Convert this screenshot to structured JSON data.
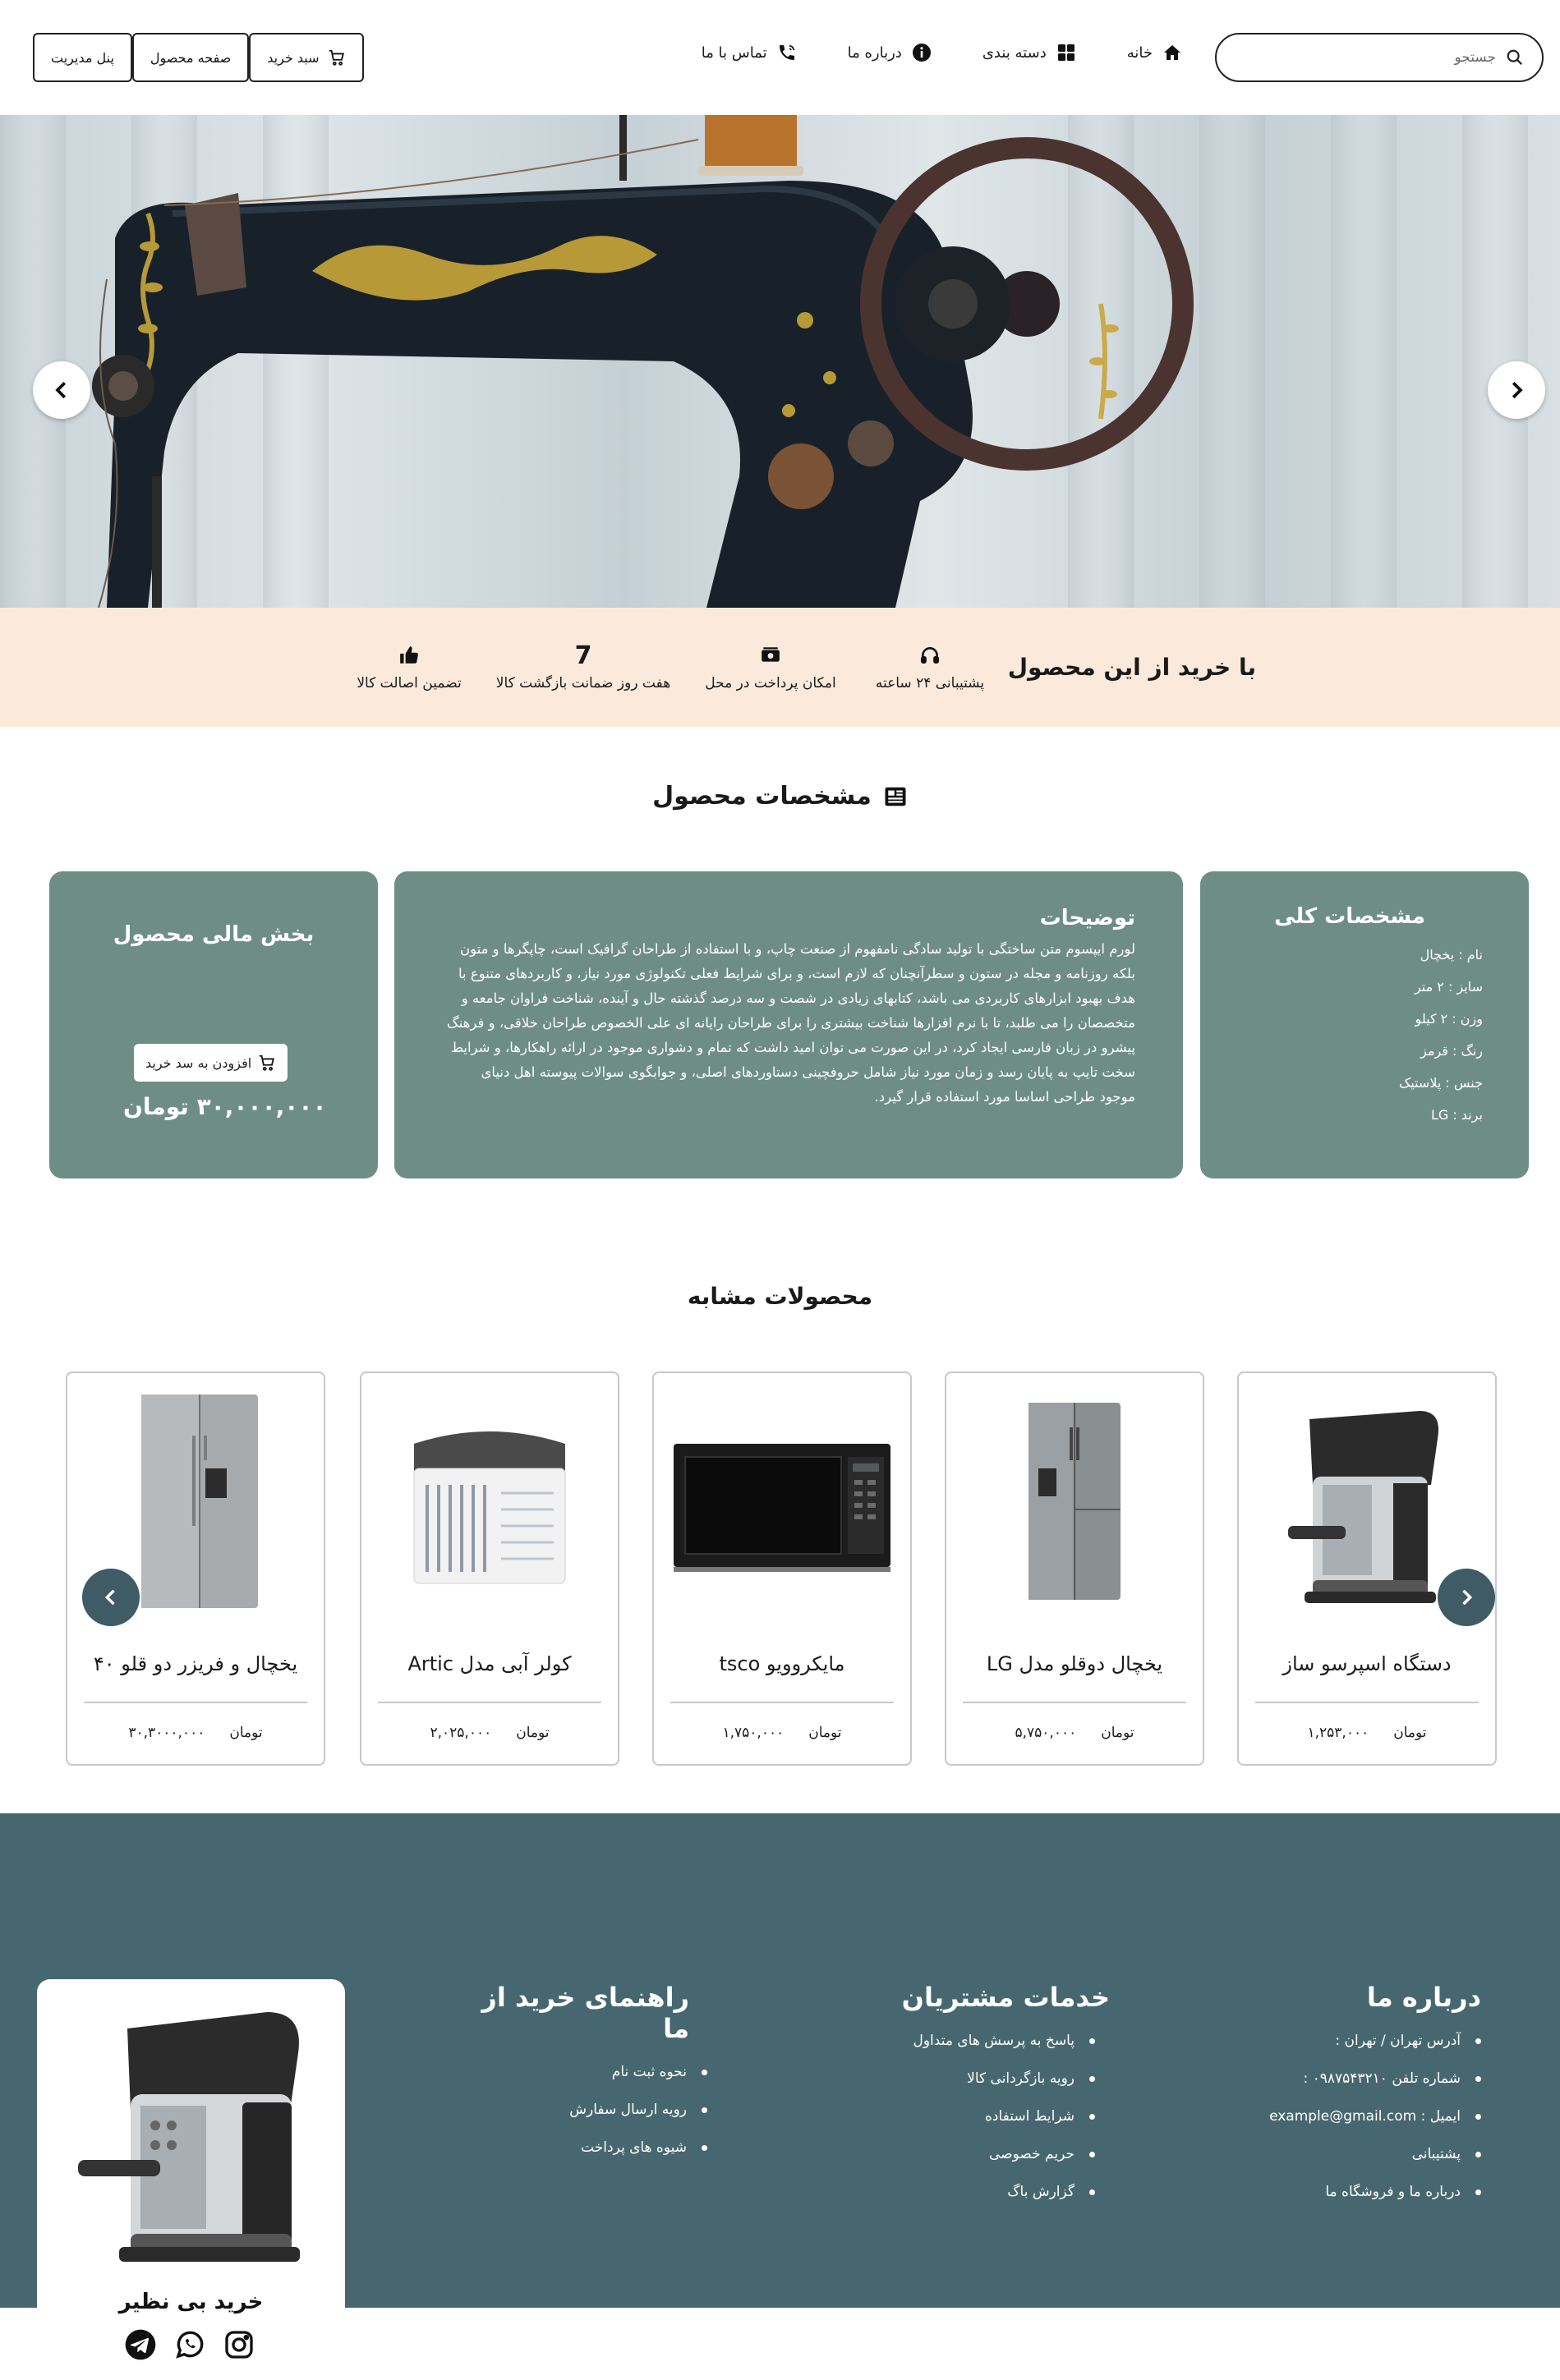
{
  "header": {
    "search_placeholder": "جستجو",
    "nav": [
      {
        "label": "خانه",
        "icon": "home-icon"
      },
      {
        "label": "دسته بندی",
        "icon": "grid-icon"
      },
      {
        "label": "درباره ما",
        "icon": "info-icon"
      },
      {
        "label": "تماس با ما",
        "icon": "phone-icon"
      }
    ],
    "buttons": {
      "admin": "پنل مدیریت",
      "product_page": "صفحه محصول",
      "cart": "سبد خرید"
    }
  },
  "benefits": {
    "title": "با خرید از این محصول",
    "items": [
      {
        "label": "پشتیبانی ۲۴ ساعته",
        "icon": "headset-icon"
      },
      {
        "label": "امکان پرداخت در محل",
        "icon": "money-icon"
      },
      {
        "label": "هفت روز ضمانت بازگشت کالا",
        "icon_text": "7"
      },
      {
        "label": "تضمین اصالت کالا",
        "icon": "thumbs-up-icon"
      }
    ]
  },
  "specs": {
    "title": "مشخصات محصول",
    "general": {
      "title": "مشخصات کلی",
      "rows": [
        "نام :  یخچال",
        "سایز :  ۲ متر",
        "وزن :  ۲ کیلو",
        "رنگ :  قرمز",
        "جنس :  پلاستیک",
        "برند :  LG"
      ]
    },
    "description": {
      "title": "توضیحات",
      "text": "لورم ایپسوم متن ساختگی با تولید سادگی نامفهوم از صنعت چاپ، و با استفاده از طراحان گرافیک است، چاپگرها و متون بلکه روزنامه و مجله در ستون و سطرآنچنان که لازم است، و برای شرایط فعلی تکنولوژی مورد نیاز، و کاربردهای متنوع با هدف بهبود ابزارهای کاربردی می باشد، کتابهای زیادی در شصت و سه درصد گذشته حال و آینده، شناخت فراوان جامعه و متخصصان را می طلبد، تا با نرم افزارها شناخت بیشتری را برای طراحان رایانه ای علی الخصوص طراحان خلاقی، و فرهنگ پیشرو در زبان فارسی ایجاد کرد، در این صورت می توان امید داشت که تمام و دشواری موجود در ارائه راهکارها، و شرایط سخت تایپ به پایان رسد و زمان مورد نیاز شامل حروفچینی دستاوردهای اصلی، و جوابگوی سوالات پیوسته اهل دنیای موجود طراحی اساسا مورد استفاده قرار گیرد."
    },
    "finance": {
      "title": "بخش مالی محصول",
      "add_to_cart": "افزودن به سد خرید",
      "price": "۳۰,۰۰۰,۰۰۰ تومان"
    }
  },
  "similar": {
    "title": "محصولات مشابه",
    "currency": "تومان",
    "items": [
      {
        "name": "دستگاه اسپرسو ساز",
        "price": "۱,۲۵۳,۰۰۰",
        "image": "espresso-machine"
      },
      {
        "name": "یخچال دوقلو مدل LG",
        "price": "۵,۷۵۰,۰۰۰",
        "image": "side-by-side-fridge"
      },
      {
        "name": "مایکروویو tsco",
        "price": "۱,۷۵۰,۰۰۰",
        "image": "microwave"
      },
      {
        "name": "کولر آبی مدل Artic",
        "price": "۲,۰۲۵,۰۰۰",
        "image": "air-cooler"
      },
      {
        "name": "یخچال و فریزر دو قلو ۴۰",
        "price": "۳۰,۳۰۰۰,۰۰۰",
        "image": "double-fridge"
      }
    ]
  },
  "footer": {
    "about": {
      "title": "درباره ما",
      "items": [
        "آدرس تهران / تهران :",
        "شماره تلفن ۰۹۸۷۵۴۳۲۱۰ :",
        "ایمیل : example@gmail.com",
        "پشتیبانی",
        "درباره ما و فروشگاه ما"
      ]
    },
    "services": {
      "title": "خدمات مشتریان",
      "items": [
        "پاسخ به پرسش های متداول",
        "رویه بازگردانی کالا",
        "شرایط استفاده",
        "حریم خصوصی",
        "گزارش باگ"
      ]
    },
    "guide": {
      "title": "راهنمای خرید از ما",
      "items": [
        "نحوه ثبت نام",
        "رویه ارسال سفارش",
        "شیوه های پرداخت"
      ]
    },
    "tagline": "خرید بی نظیر"
  },
  "colors": {
    "accent": "#6e8e85",
    "footer": "#476770",
    "benefits_bg": "#fbeadb",
    "carousel_arrow": "#3e5b66"
  }
}
